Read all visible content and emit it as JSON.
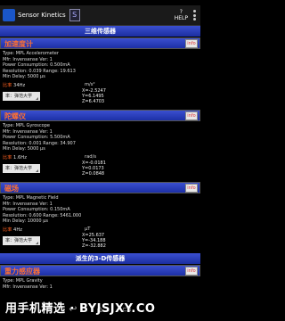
{
  "app": {
    "title": "Sensor Kinetics",
    "badge": "S",
    "help_label": "HELP"
  },
  "sections": {
    "three_axis": "三维传感器",
    "derived": "派生的3-D传感器"
  },
  "info_button_label": "info",
  "sensors": [
    {
      "name": "加速度计",
      "info": [
        "Type: MPL Accelerometer",
        "Mfr: Invensense  Ver: 1",
        "Power Consumption: 0.500mA",
        "Resolution: 0.039 Range: 19.613",
        "Min Delay: 5000 µs"
      ],
      "rate_label": "比率",
      "rate_value": "34Hz",
      "selector": "率：弹范大学",
      "unit": "m/s²",
      "x": "X=-2.5247",
      "y": "Y=6.1495",
      "z": "Z=6.4703"
    },
    {
      "name": "陀螺仪",
      "info": [
        "Type: MPL Gyroscope",
        "Mfr: Invensense  Ver: 1",
        "Power Consumption: 5.500mA",
        "Resolution: 0.001 Range: 34.907",
        "Min Delay: 5000 µs"
      ],
      "rate_label": "比率",
      "rate_value": "1.6Hz",
      "selector": "率：弹范大学",
      "unit": "rad/s",
      "x": "X=-0.0181",
      "y": "Y=0.0173",
      "z": "Z=0.0848"
    },
    {
      "name": "磁场",
      "info": [
        "Type: MPL Magnetic Field",
        "Mfr: Invensense  Ver: 1",
        "Power Consumption: 0.150mA",
        "Resolution: 0.600 Range: 5461.000",
        "Min Delay: 10000 µs"
      ],
      "rate_label": "比率",
      "rate_value": "4Hz",
      "selector": "率：弹范大学",
      "unit": "µT",
      "x": "X=25.637",
      "y": "Y=-34.188",
      "z": "Z=-32.882"
    },
    {
      "name": "重力感应器",
      "info": [
        "Type: MPL Gravity",
        "Mfr: Invensense  Ver: 1"
      ]
    }
  ],
  "watermark": "用手机精选 · BYJSJXY.CO",
  "nav": {
    "back": "↩",
    "home": "⌂",
    "recent": "▭"
  },
  "colors": {
    "header_blue": "#2a3fc0",
    "sensor_name": "#ff7030",
    "rate_label": "#ff6020"
  }
}
